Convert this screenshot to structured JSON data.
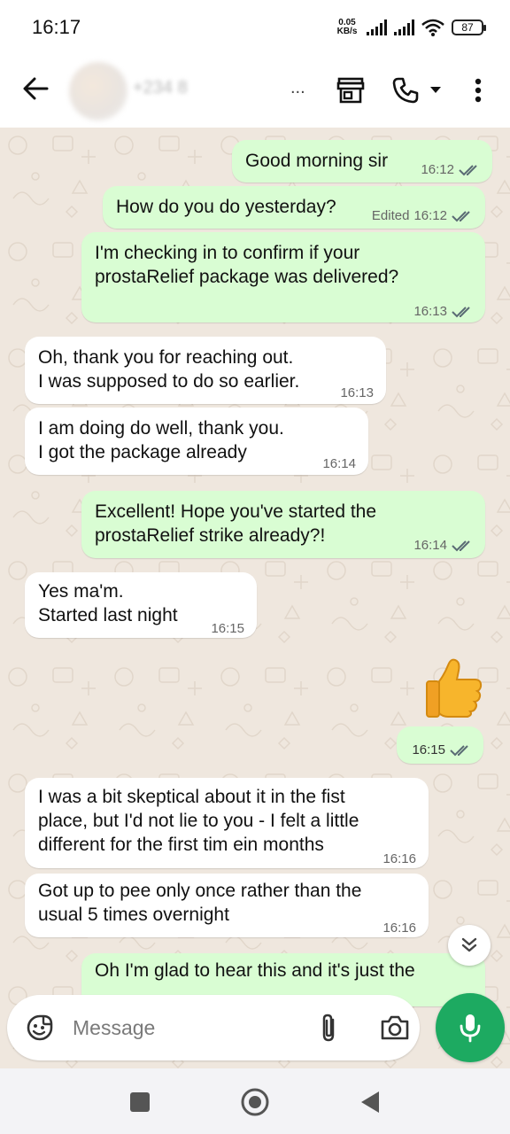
{
  "status_bar": {
    "time": "16:17",
    "net_speed_value": "0.05",
    "net_speed_unit": "KB/s",
    "battery": "87"
  },
  "header": {
    "contact_name": "+234 8",
    "contact_name_suffix": "...",
    "icons": [
      "back-arrow-icon",
      "avatar",
      "store-icon",
      "phone-icon",
      "dropdown-icon",
      "more-vert-icon"
    ]
  },
  "messages": [
    {
      "dir": "out",
      "text": "Good morning sir",
      "time": "16:12",
      "ticks": true
    },
    {
      "dir": "out",
      "text": "How do you do yesterday?",
      "edited": "Edited",
      "time": "16:12",
      "ticks": true
    },
    {
      "dir": "out",
      "text": "I'm checking in to confirm if your\nprostaRelief package was delivered?",
      "time": "16:13",
      "ticks": true
    },
    {
      "dir": "in",
      "text": "Oh, thank you for reaching out.\nI was supposed to do so earlier.",
      "time": "16:13"
    },
    {
      "dir": "in",
      "text": "I am doing do well, thank you.\nI got the package already",
      "time": "16:14"
    },
    {
      "dir": "out",
      "text": "Excellent! Hope you've started the\nprostaRelief strike already?!",
      "time": "16:14",
      "ticks": true
    },
    {
      "dir": "in",
      "text": "Yes ma'm.\nStarted last night",
      "time": "16:15"
    },
    {
      "dir": "out",
      "emoji": "thumbs-up",
      "time": "16:15",
      "ticks": true
    },
    {
      "dir": "in",
      "text": "I was a bit skeptical about it in the fist\nplace, but I'd not lie to you - I felt a little\ndifferent for the first tim ein months",
      "time": "16:16"
    },
    {
      "dir": "in",
      "text": "Got up to pee only once rather than the\nusual 5 times overnight",
      "time": "16:16"
    },
    {
      "dir": "out",
      "text": "Oh I'm glad to hear this and it's just the",
      "partial": true
    }
  ],
  "composer": {
    "placeholder": "Message",
    "icons": [
      "emoji-sticker-icon",
      "attach-icon",
      "camera-icon",
      "mic-icon"
    ]
  },
  "colors": {
    "outgoing_bubble": "#d9fdd3",
    "incoming_bubble": "#ffffff",
    "chat_background": "#efe7de",
    "ticks": "#5a6b74",
    "mic_button": "#1daa61"
  }
}
